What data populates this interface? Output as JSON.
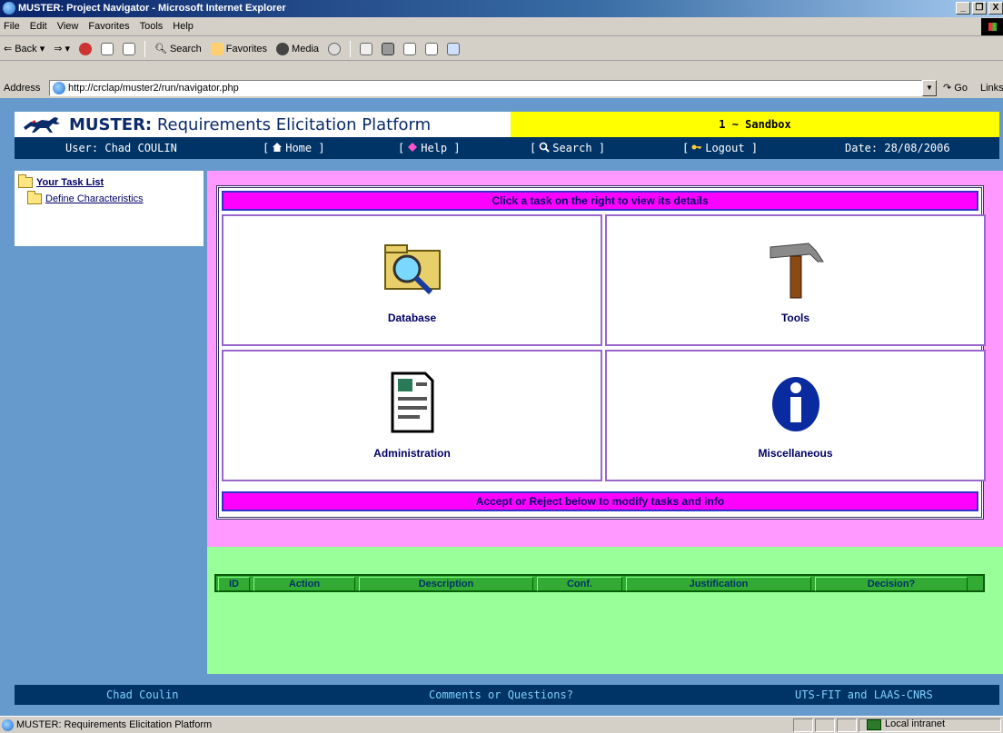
{
  "window": {
    "title": "MUSTER: Project Navigator - Microsoft Internet Explorer",
    "controls": [
      "_",
      "❐",
      "X"
    ]
  },
  "menu": [
    "File",
    "Edit",
    "View",
    "Favorites",
    "Tools",
    "Help"
  ],
  "toolbar": {
    "back": "Back",
    "search": "Search",
    "favorites": "Favorites",
    "media": "Media"
  },
  "address": {
    "label": "Address",
    "url": "http://crclap/muster2/run/navigator.php",
    "go": "Go",
    "links": "Links"
  },
  "header": {
    "app_brand": "MUSTER:",
    "app_title": " Requirements Elicitation Platform",
    "project": "1 ~ Sandbox"
  },
  "navbar": {
    "user": "User: Chad COULIN",
    "home": "Home",
    "help": "Help",
    "search": "Search",
    "logout": "Logout",
    "date": "Date: 28/08/2006"
  },
  "sidebar": {
    "task_list": "Your Task List",
    "items": [
      "Define Characteristics"
    ]
  },
  "main": {
    "top_banner": "Click a task on the right to view its details",
    "bottom_banner": "Accept or Reject below to modify tasks and info",
    "tiles": [
      {
        "label": "Database",
        "icon": "search-folder-icon"
      },
      {
        "label": "Tools",
        "icon": "hammer-icon"
      },
      {
        "label": "Administration",
        "icon": "document-icon"
      },
      {
        "label": "Miscellaneous",
        "icon": "info-icon"
      }
    ]
  },
  "table": {
    "headers": [
      "ID",
      "Action",
      "Description",
      "Conf.",
      "Justification",
      "Decision?"
    ]
  },
  "footer": {
    "left": "Chad Coulin",
    "center": "Comments or Questions?",
    "right": "UTS-FIT and LAAS-CNRS"
  },
  "status": {
    "message": "MUSTER: Requirements Elicitation Platform",
    "zone": "Local intranet"
  },
  "colors": {
    "navbar": "#003366",
    "project_bar": "#ffff00",
    "main_pink": "#ff99ff",
    "banner_magenta": "#ff00ff",
    "table_green": "#33aa33",
    "lower_green": "#99ff99",
    "page_blue": "#6699cc"
  }
}
